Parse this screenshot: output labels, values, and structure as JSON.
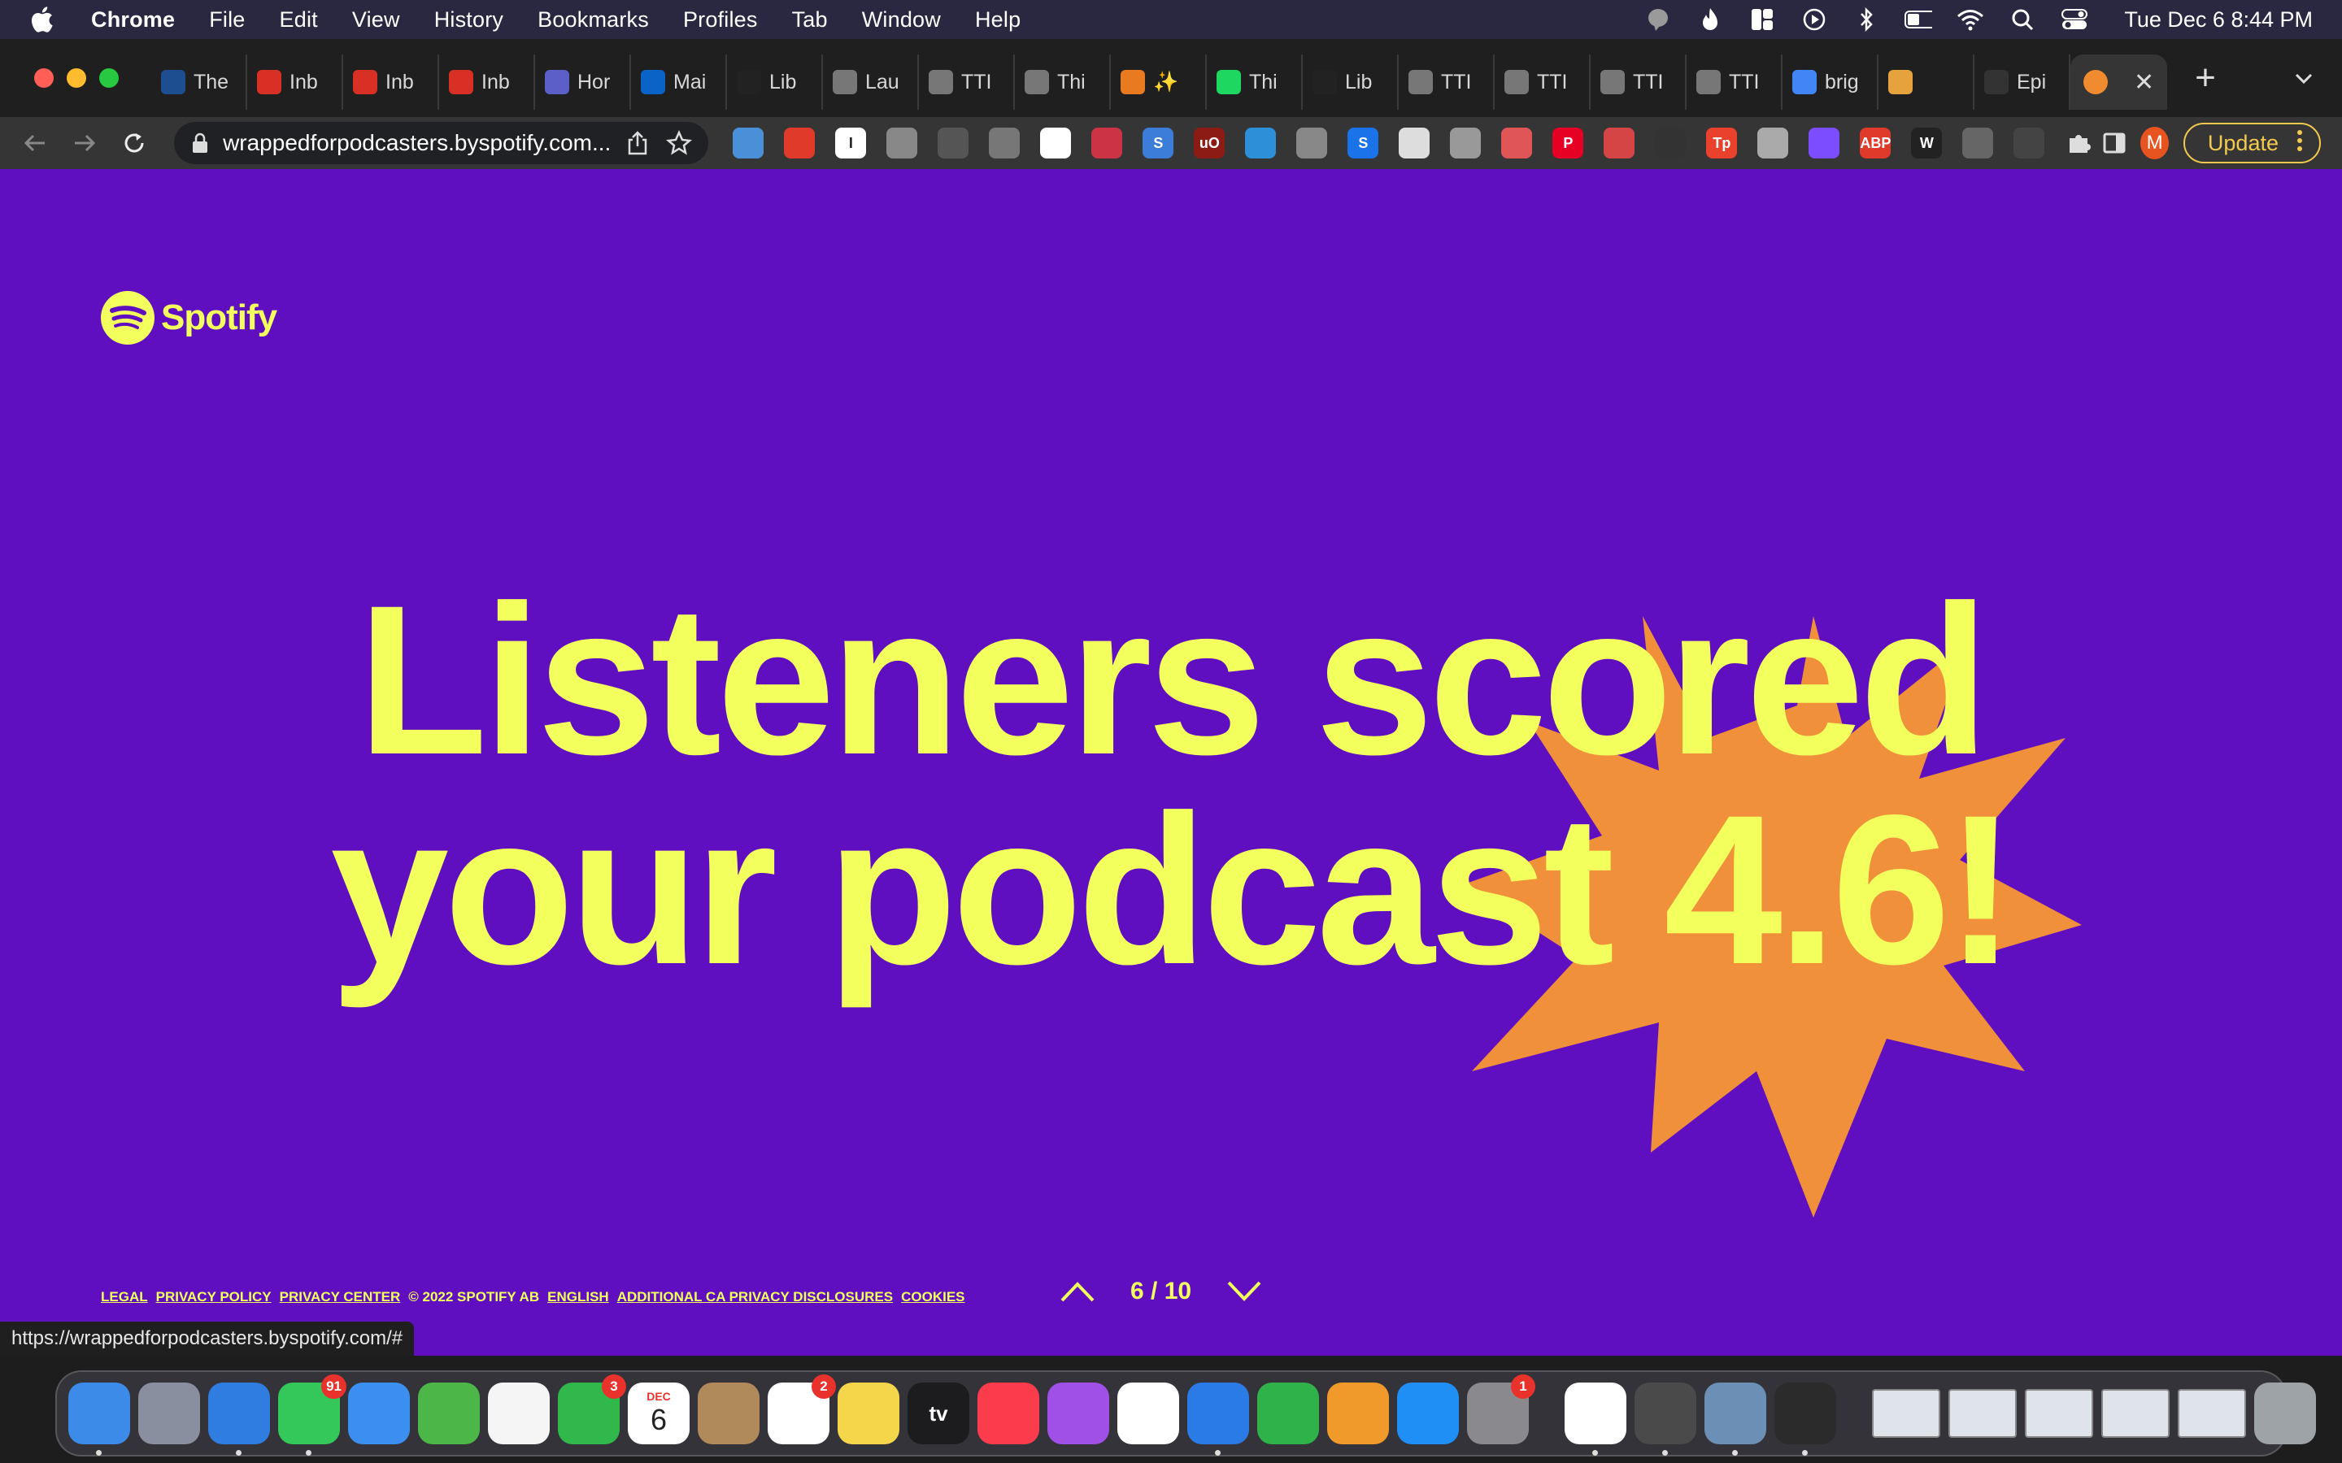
{
  "menubar": {
    "app_name": "Chrome",
    "items": [
      "File",
      "Edit",
      "View",
      "History",
      "Bookmarks",
      "Profiles",
      "Tab",
      "Window",
      "Help"
    ],
    "clock": "Tue Dec 6  8:44 PM"
  },
  "tabs": [
    {
      "title": "The",
      "color": "#1d4e8f"
    },
    {
      "title": "Inb",
      "color": "#d93025"
    },
    {
      "title": "Inb",
      "color": "#d93025"
    },
    {
      "title": "Inb",
      "color": "#d93025"
    },
    {
      "title": "Hor",
      "color": "#5b5fc7"
    },
    {
      "title": "Mai",
      "color": "#0a64c8"
    },
    {
      "title": "Lib",
      "color": "#222222"
    },
    {
      "title": "Lau",
      "color": "#777777"
    },
    {
      "title": "TTI",
      "color": "#777777"
    },
    {
      "title": "Thi",
      "color": "#777777"
    },
    {
      "title": "✨",
      "color": "#e97a1f"
    },
    {
      "title": "Thi",
      "color": "#1ed760"
    },
    {
      "title": "Lib",
      "color": "#222222"
    },
    {
      "title": "TTI",
      "color": "#777777"
    },
    {
      "title": "TTI",
      "color": "#777777"
    },
    {
      "title": "TTI",
      "color": "#777777"
    },
    {
      "title": "TTI",
      "color": "#777777"
    },
    {
      "title": "brig",
      "color": "#4285f4"
    },
    {
      "title": "",
      "color": "#e6a23c"
    },
    {
      "title": "Epi",
      "color": "#333333"
    }
  ],
  "active_tab": {
    "title": "",
    "color": "#f08c2f"
  },
  "toolbar": {
    "url": "wrappedforpodcasters.byspotify.com...",
    "update_label": "Update",
    "profile_initial": "M"
  },
  "extensions": [
    {
      "label": "",
      "color": "#4a90d9"
    },
    {
      "label": "",
      "color": "#e03a2a"
    },
    {
      "label": "I",
      "color": "#ffffff"
    },
    {
      "label": "",
      "color": "#888888"
    },
    {
      "label": "",
      "color": "#555555"
    },
    {
      "label": "",
      "color": "#777777"
    },
    {
      "label": "",
      "color": "#ffffff"
    },
    {
      "label": "",
      "color": "#cc3344"
    },
    {
      "label": "S",
      "color": "#3b7dd8"
    },
    {
      "label": "uO",
      "color": "#8c1b13"
    },
    {
      "label": "",
      "color": "#2d8fd8"
    },
    {
      "label": "",
      "color": "#888888"
    },
    {
      "label": "S",
      "color": "#1a73e8"
    },
    {
      "label": "",
      "color": "#dddddd"
    },
    {
      "label": "",
      "color": "#999999"
    },
    {
      "label": "",
      "color": "#e05555"
    },
    {
      "label": "P",
      "color": "#e60023"
    },
    {
      "label": "",
      "color": "#d64545"
    },
    {
      "label": "",
      "color": "#333333"
    },
    {
      "label": "Tp",
      "color": "#e8412c"
    },
    {
      "label": "",
      "color": "#aaaaaa"
    },
    {
      "label": "",
      "color": "#7c4dff"
    },
    {
      "label": "ABP",
      "color": "#e03a2a"
    },
    {
      "label": "W",
      "color": "#222222"
    },
    {
      "label": "",
      "color": "#666666"
    },
    {
      "label": "",
      "color": "#444444"
    }
  ],
  "page": {
    "brand": "Spotify",
    "headline_line1": "Listeners scored",
    "headline_line2": "your podcast 4.6!",
    "footer_links": [
      "LEGAL",
      "PRIVACY POLICY",
      "PRIVACY CENTER",
      "© 2022 SPOTIFY AB",
      "ENGLISH",
      "ADDITIONAL CA PRIVACY DISCLOSURES",
      "COOKIES"
    ],
    "pager": "6 / 10",
    "status_url": "https://wrappedforpodcasters.byspotify.com/#",
    "colors": {
      "background": "#5f0fbf",
      "accent": "#f2ff5c",
      "burst": "#f0903a"
    }
  },
  "dock": {
    "apps": [
      {
        "name": "Finder",
        "color": "#3d8be8",
        "badge": "",
        "running": true
      },
      {
        "name": "Launchpad",
        "color": "#8a8fa0",
        "badge": "",
        "running": false
      },
      {
        "name": "Safari",
        "color": "#2f7de1",
        "badge": "",
        "running": true
      },
      {
        "name": "Messages",
        "color": "#34c759",
        "badge": "91",
        "running": true
      },
      {
        "name": "Mail",
        "color": "#3b8ff0",
        "badge": "",
        "running": false
      },
      {
        "name": "Maps",
        "color": "#4cb648",
        "badge": "",
        "running": false
      },
      {
        "name": "Photos",
        "color": "#f5f5f5",
        "badge": "",
        "running": false
      },
      {
        "name": "FaceTime",
        "color": "#30b84a",
        "badge": "3",
        "running": false
      },
      {
        "name": "Calendar",
        "color": "#ffffff",
        "badge": "",
        "running": false
      },
      {
        "name": "Contacts",
        "color": "#b08a5a",
        "badge": "",
        "running": false
      },
      {
        "name": "Reminders",
        "color": "#ffffff",
        "badge": "2",
        "running": false
      },
      {
        "name": "Notes",
        "color": "#f5d54a",
        "badge": "",
        "running": false
      },
      {
        "name": "TV",
        "color": "#1c1c1e",
        "badge": "",
        "running": false
      },
      {
        "name": "Music",
        "color": "#fa3c4c",
        "badge": "",
        "running": false
      },
      {
        "name": "Podcasts",
        "color": "#a050e6",
        "badge": "",
        "running": false
      },
      {
        "name": "News",
        "color": "#ffffff",
        "badge": "",
        "running": false
      },
      {
        "name": "Keynote",
        "color": "#2b7be6",
        "badge": "",
        "running": true
      },
      {
        "name": "Numbers",
        "color": "#2fb24a",
        "badge": "",
        "running": false
      },
      {
        "name": "Pages",
        "color": "#f09a2b",
        "badge": "",
        "running": false
      },
      {
        "name": "App Store",
        "color": "#1f8ff5",
        "badge": "",
        "running": false
      },
      {
        "name": "System Preferences",
        "color": "#8a8a8e",
        "badge": "1",
        "running": false
      },
      {
        "name": "Chrome",
        "color": "#ffffff",
        "badge": "",
        "running": true
      },
      {
        "name": "Sublime Text",
        "color": "#4a4a4a",
        "badge": "",
        "running": true
      },
      {
        "name": "Preview",
        "color": "#6c8fb5",
        "badge": "",
        "running": true
      },
      {
        "name": "QuickTime",
        "color": "#2b2b2b",
        "badge": "",
        "running": true
      }
    ],
    "calendar_month": "DEC",
    "calendar_day": "6",
    "tv_label": "tv"
  }
}
